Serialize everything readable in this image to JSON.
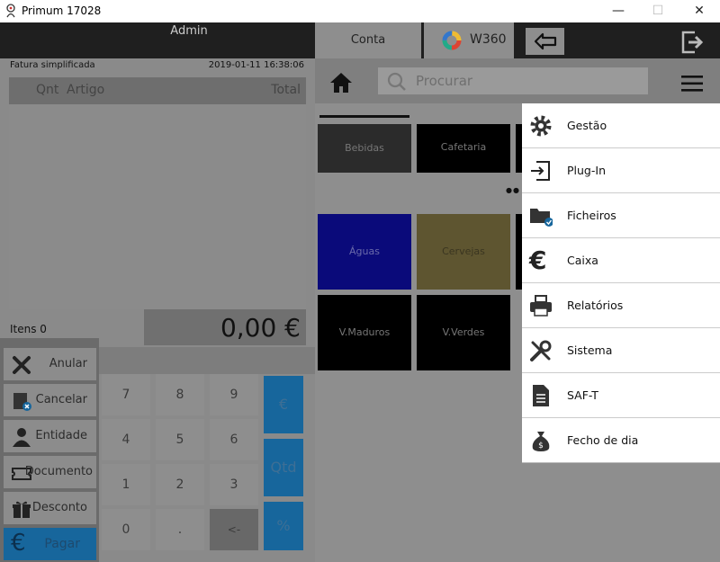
{
  "window": {
    "title": "Primum 17028",
    "minimize": "—",
    "maximize": "☐",
    "close": "✕"
  },
  "left": {
    "user": "Admin",
    "doc_type": "Fatura simplificada",
    "doc_date": "2019-01-11 16:38:06",
    "columns": {
      "qty": "Qnt",
      "item": "Artigo",
      "total": "Total"
    },
    "items_count": "Itens 0",
    "total": "0,00 €"
  },
  "actions": [
    {
      "label": "Anular",
      "icon": "close-icon"
    },
    {
      "label": "Cancelar",
      "icon": "cancel-document-icon"
    },
    {
      "label": "Entidade",
      "icon": "user-icon"
    },
    {
      "label": "Documento",
      "icon": "ticket-icon"
    },
    {
      "label": "Desconto",
      "icon": "gift-icon"
    },
    {
      "label": "Pagar",
      "icon": "euro-icon"
    }
  ],
  "keypad": {
    "keys": [
      "7",
      "8",
      "9",
      "4",
      "5",
      "6",
      "1",
      "2",
      "3",
      "0",
      ".",
      "<-"
    ],
    "side": [
      "€",
      "Qtd",
      "%"
    ]
  },
  "tabs": {
    "conta": "Conta",
    "w360": "W360"
  },
  "search": {
    "placeholder": "Procurar"
  },
  "categories": [
    {
      "label": "Bebidas",
      "color": "#2b2b2b"
    },
    {
      "label": "Cafetaria",
      "color": "#000000"
    },
    {
      "label": "Águas",
      "color": "#0a0a7a"
    },
    {
      "label": "Cervejas",
      "color": "#5e5530"
    },
    {
      "label": "V.Maduros",
      "color": "#000000"
    },
    {
      "label": "V.Verdes",
      "color": "#000000"
    }
  ],
  "menu": [
    {
      "label": "Gestão",
      "icon": "gear-icon"
    },
    {
      "label": "Plug-In",
      "icon": "plug-in-icon"
    },
    {
      "label": "Ficheiros",
      "icon": "folder-icon"
    },
    {
      "label": "Caixa",
      "icon": "euro-icon"
    },
    {
      "label": "Relatórios",
      "icon": "printer-icon"
    },
    {
      "label": "Sistema",
      "icon": "tools-icon"
    },
    {
      "label": "SAF-T",
      "icon": "document-icon"
    },
    {
      "label": "Fecho de dia",
      "icon": "money-bag-icon"
    }
  ],
  "colors": {
    "accent_blue": "#17669c",
    "dark_bar": "#1f1f1f",
    "menu_bg": "#ffffff"
  }
}
